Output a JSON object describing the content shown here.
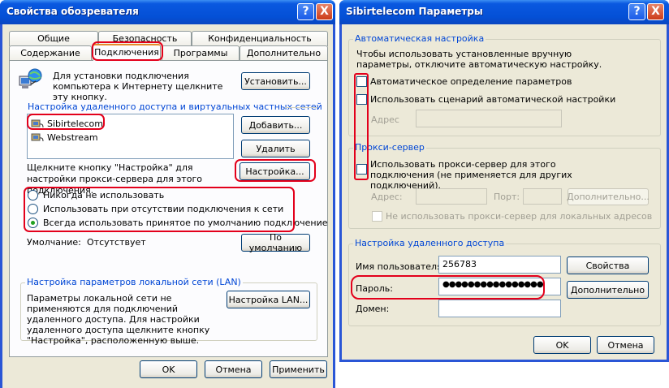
{
  "left_window": {
    "title": "Свойства обозревателя",
    "help_btn": "?",
    "close_btn": "X",
    "tabs_row1": [
      "Общие",
      "Безопасность",
      "Конфиденциальность"
    ],
    "tabs_row2": [
      "Содержание",
      "Подключения",
      "Программы",
      "Дополнительно"
    ],
    "setup_text": "Для установки подключения компьютера к Интернету щелкните эту кнопку.",
    "setup_btn": "Установить...",
    "dialup_group": "Настройка удаленного доступа и виртуальных частных сетей",
    "connections": [
      "Sibirtelecom",
      "Webstream"
    ],
    "add_btn": "Добавить...",
    "delete_btn": "Удалить",
    "proxy_hint": "Щелкните кнопку \"Настройка\" для настройки прокси-сервера для этого подключения.",
    "settings_btn": "Настройка...",
    "radios": [
      "Никогда не использовать",
      "Использовать при отсутствии подключения к сети",
      "Всегда использовать принятое по умолчанию подключение"
    ],
    "default_label": "Умолчание:",
    "default_value": "Отсутствует",
    "default_btn": "По умолчанию",
    "lan_group": "Настройка параметров локальной сети (LAN)",
    "lan_text": "Параметры локальной сети не применяются для подключений удаленного доступа. Для настройки удаленного доступа щелкните кнопку \"Настройка\", расположенную выше.",
    "lan_btn": "Настройка LAN...",
    "ok": "OK",
    "cancel": "Отмена",
    "apply": "Применить"
  },
  "right_window": {
    "title": "Sibirtelecom Параметры",
    "help_btn": "?",
    "close_btn": "X",
    "auto_group": "Автоматическая настройка",
    "auto_text": "Чтобы использовать установленные вручную параметры, отключите автоматическую настройку.",
    "auto_detect": "Автоматическое определение параметров",
    "auto_script": "Использовать сценарий автоматической настройки",
    "address_label": "Адрес",
    "proxy_group": "Прокси-сервер",
    "use_proxy": "Использовать прокси-сервер для этого подключения (не применяется для других подключений).",
    "proxy_addr_label": "Адрес:",
    "port_label": "Порт:",
    "advanced_btn_disabled": "Дополнительно...",
    "bypass_local": "Не использовать прокси-сервер для локальных адресов",
    "dialup_group": "Настройка удаленного доступа",
    "user_label": "Имя пользователя:",
    "user_value": "256783",
    "properties_btn": "Свойства",
    "password_label": "Пароль:",
    "password_value": "●●●●●●●●●●●●●●●●",
    "advanced_btn": "Дополнительно",
    "domain_label": "Домен:",
    "domain_value": "",
    "ok": "OK",
    "cancel": "Отмена"
  },
  "colors": {
    "title_blue": "#0450d6",
    "highlight_red": "#e3001b",
    "face": "#ece9d8",
    "group_label": "#0046d5"
  }
}
